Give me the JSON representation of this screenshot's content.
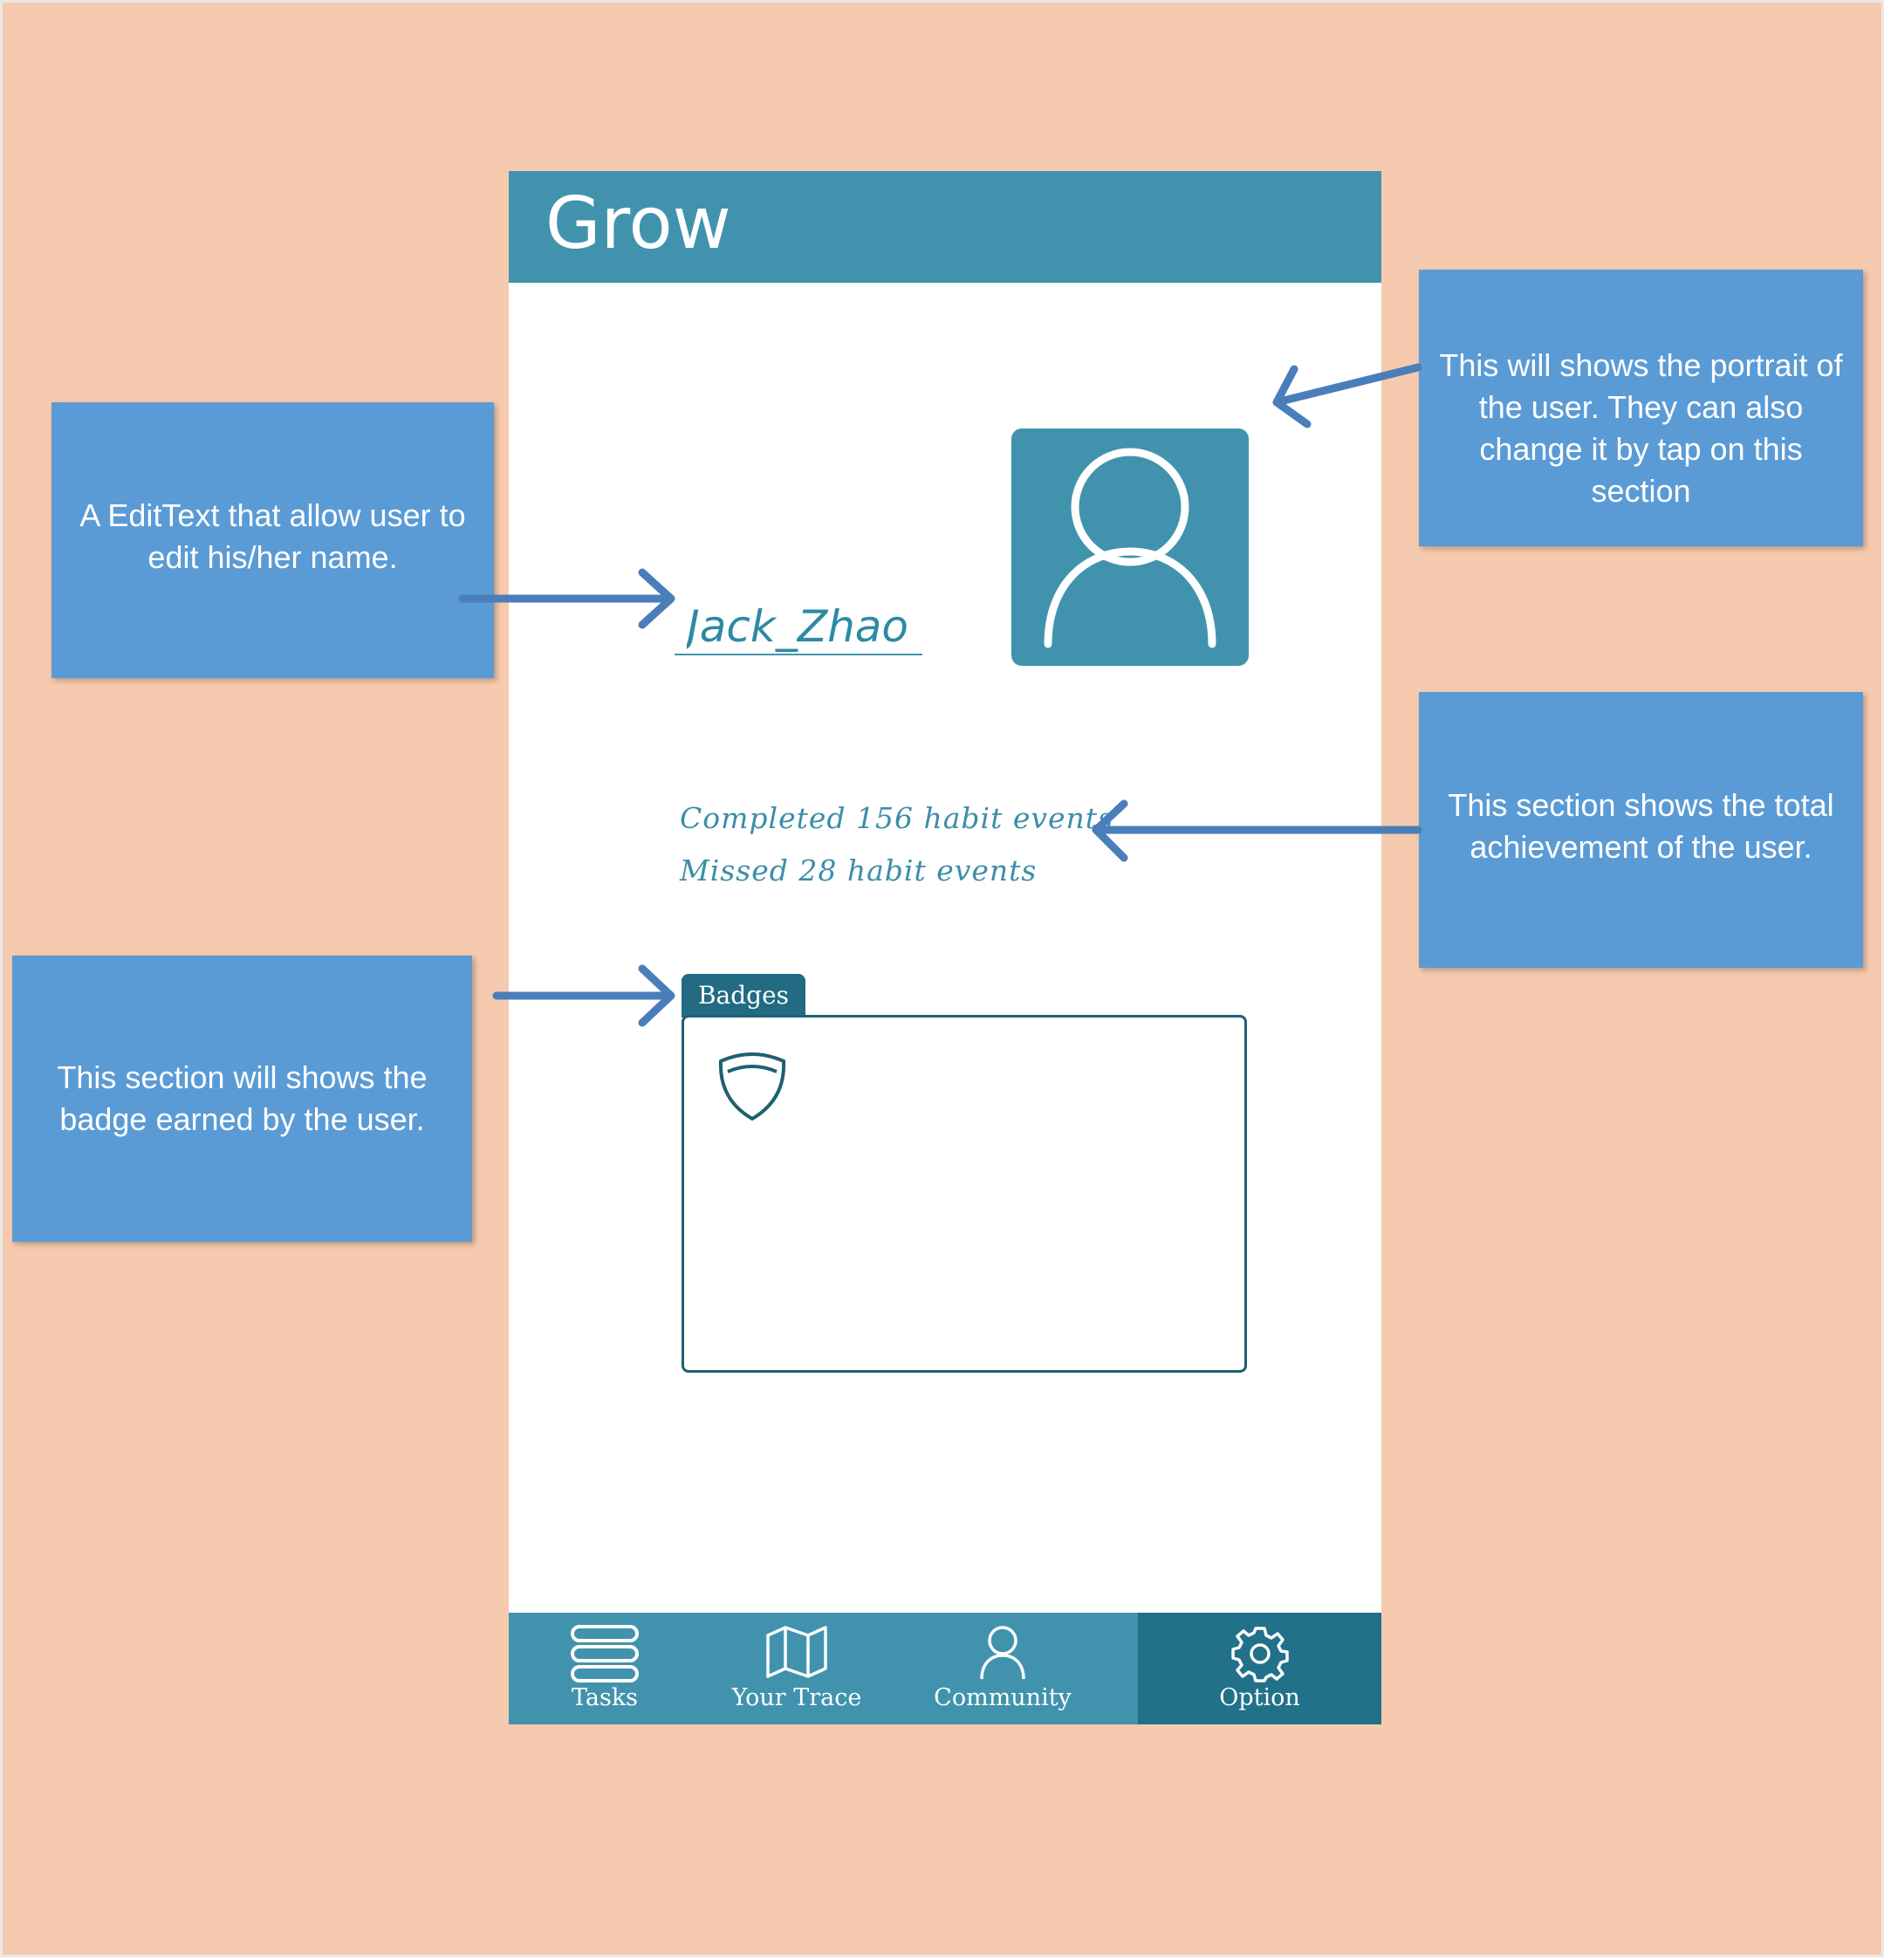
{
  "app": {
    "title": "Grow"
  },
  "profile": {
    "name_value": "Jack_Zhao",
    "completed_text": "Completed 156 habit events",
    "missed_text": "Missed 28 habit events"
  },
  "badges": {
    "tab_label": "Badges"
  },
  "nav": {
    "items": [
      {
        "label": "Tasks",
        "icon": "list-icon"
      },
      {
        "label": "Your Trace",
        "icon": "map-icon"
      },
      {
        "label": "Community",
        "icon": "person-icon"
      },
      {
        "label": "Option",
        "icon": "gear-icon",
        "active": true
      }
    ]
  },
  "annotations": {
    "name": "A EditText that allow user to edit his/her name.",
    "portrait": "This will shows the portrait of the user. They can also change it by tap on this section",
    "achievement": "This section shows the total achievement of the user.",
    "badge": "This section will shows the badge earned by the user."
  },
  "colors": {
    "background": "#f6caae",
    "primary": "#4193ad",
    "primary_dark": "#21718a",
    "callout": "#5b9bd5",
    "arrow": "#4a7ebb"
  }
}
